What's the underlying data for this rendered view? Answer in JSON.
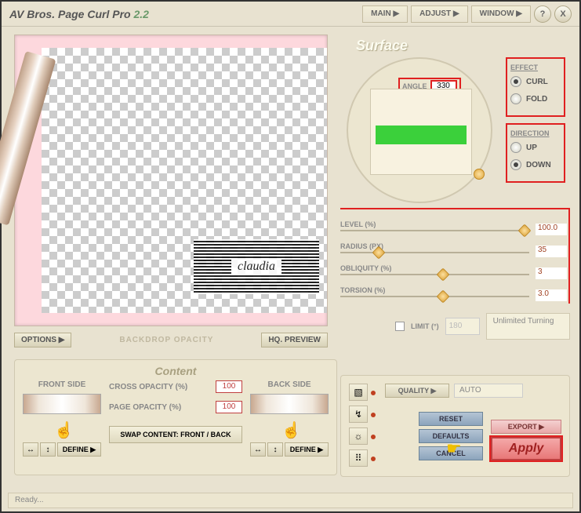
{
  "title": {
    "brand": "AV Bros.",
    "product": "Page Curl Pro",
    "version": "2.2"
  },
  "topnav": {
    "main": "MAIN ▶",
    "adjust": "ADJUST ▶",
    "window": "WINDOW ▶",
    "help": "?",
    "close": "X"
  },
  "mid": {
    "options": "OPTIONS ▶",
    "backdrop": "BACKDROP OPACITY",
    "hq": "HQ. PREVIEW"
  },
  "content": {
    "title": "Content",
    "front_label": "FRONT SIDE",
    "back_label": "BACK SIDE",
    "cross_label": "CROSS OPACITY (%)",
    "page_label": "PAGE OPACITY (%)",
    "cross_val": "100",
    "page_val": "100",
    "swap": "SWAP CONTENT: FRONT / BACK",
    "define": "DEFINE ▶",
    "flip_h": "↔",
    "flip_v": "↕"
  },
  "surface": {
    "title": "Surface",
    "angle_label": "ANGLE",
    "angle_val": "330",
    "effect_label": "EFFECT",
    "curl": "CURL",
    "fold": "FOLD",
    "direction_label": "DIRECTION",
    "up": "UP",
    "down": "DOWN",
    "sliders": {
      "level": {
        "label": "LEVEL (%)",
        "val": "100.0",
        "pos": 100
      },
      "radius": {
        "label": "RADIUS (PX)",
        "val": "35",
        "pos": 18
      },
      "obliquity": {
        "label": "OBLIQUITY (%)",
        "val": "3",
        "pos": 52
      },
      "torsion": {
        "label": "TORSION (%)",
        "val": "3.0",
        "pos": 52
      }
    },
    "limit_label": "LIMIT (°)",
    "limit_val": "180",
    "limit_info": "Unlimited Turning"
  },
  "bottom": {
    "quality": "QUALITY  ▶",
    "auto": "AUTO",
    "reset": "RESET",
    "defaults": "DEFAULTS",
    "cancel": "CANCEL",
    "export": "EXPORT  ▶",
    "apply": "Apply"
  },
  "status": "Ready...",
  "watermark": "claudia"
}
